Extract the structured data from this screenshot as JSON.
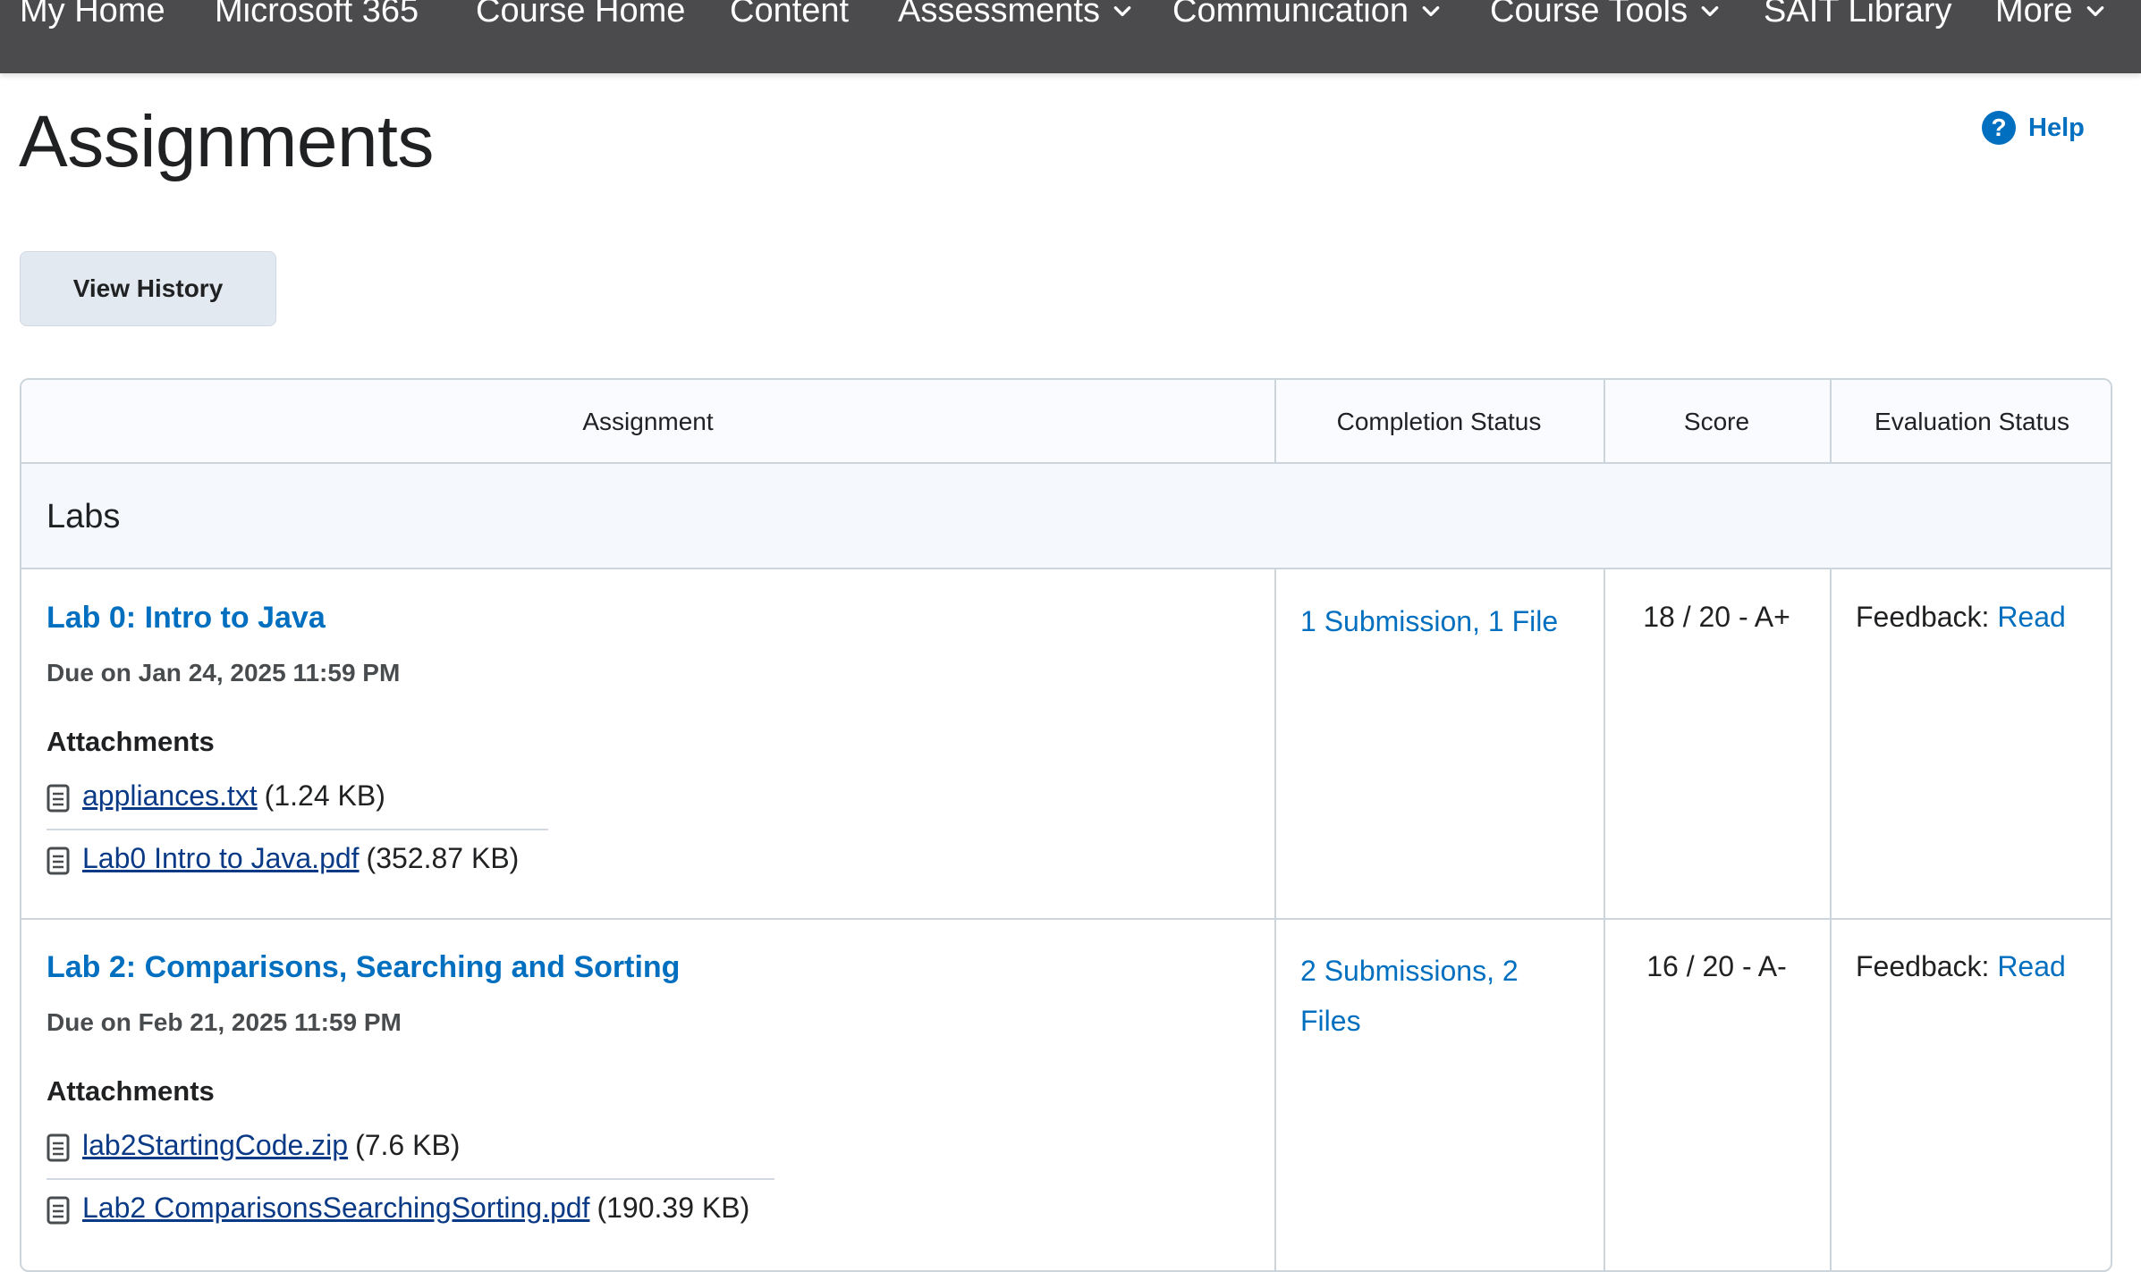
{
  "nav": {
    "items": [
      {
        "label": "My Home",
        "dropdown": false
      },
      {
        "label": "Microsoft 365",
        "dropdown": false
      },
      {
        "label": "Course Home",
        "dropdown": false
      },
      {
        "label": "Content",
        "dropdown": false
      },
      {
        "label": "Assessments",
        "dropdown": true
      },
      {
        "label": "Communication",
        "dropdown": true
      },
      {
        "label": "Course Tools",
        "dropdown": true
      },
      {
        "label": "SAIT Library",
        "dropdown": false
      },
      {
        "label": "More",
        "dropdown": true
      }
    ]
  },
  "page": {
    "title": "Assignments",
    "help_label": "Help",
    "help_icon": "question-circle-icon",
    "view_history_label": "View History"
  },
  "table": {
    "headers": [
      "Assignment",
      "Completion Status",
      "Score",
      "Evaluation Status"
    ],
    "group_label": "Labs",
    "rows": [
      {
        "title": "Lab 0: Intro to Java",
        "due": "Due on Jan 24, 2025 11:59 PM",
        "attachments_label": "Attachments",
        "attachments": [
          {
            "name": "appliances.txt",
            "size": "(1.24 KB)"
          },
          {
            "name": "Lab0 Intro to Java.pdf",
            "size": "(352.87 KB)"
          }
        ],
        "completion": "1 Submission, 1 File",
        "score": "18 / 20 - A+",
        "feedback_label": "Feedback:",
        "feedback_link": "Read"
      },
      {
        "title": "Lab 2: Comparisons, Searching and Sorting",
        "due": "Due on Feb 21, 2025 11:59 PM",
        "attachments_label": "Attachments",
        "attachments": [
          {
            "name": "lab2StartingCode.zip",
            "size": "(7.6 KB)"
          },
          {
            "name": "Lab2 ComparisonsSearchingSorting.pdf",
            "size": "(190.39 KB)"
          }
        ],
        "completion": "2 Submissions, 2 Files",
        "score": "16 / 20 - A-",
        "feedback_label": "Feedback:",
        "feedback_link": "Read"
      }
    ]
  },
  "colors": {
    "navbar": "#4b4b4d",
    "link": "#006fbf",
    "attachment_link": "#0a3a86",
    "header_bg": "#f9fbff",
    "border": "#cdd5dc"
  }
}
